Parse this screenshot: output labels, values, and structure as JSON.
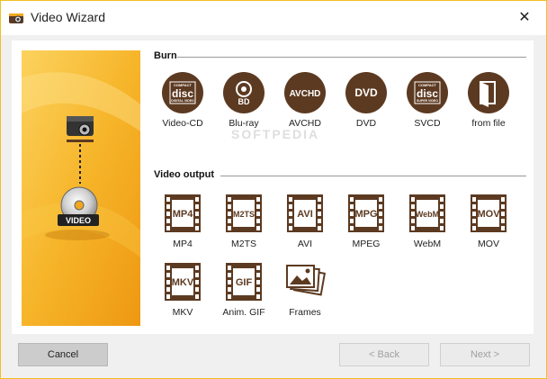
{
  "window": {
    "title": "Video Wizard",
    "close_glyph": "✕"
  },
  "colors": {
    "accent_brown": "#5c3a21",
    "banner_orange": "#f3a71e",
    "banner_light": "#fcd25e"
  },
  "banner": {
    "badge_label": "VIDEO"
  },
  "watermark": "SOFTPEDIA",
  "burn": {
    "title": "Burn",
    "items": [
      {
        "label": "Video-CD",
        "icon": "compact-disc-digital-video-icon",
        "lines": [
          "COMPACT",
          "disc",
          "DIGITAL VIDEO"
        ]
      },
      {
        "label": "Blu-ray",
        "icon": "blu-ray-disc-icon",
        "lines": [
          "BD"
        ]
      },
      {
        "label": "AVCHD",
        "icon": "avchd-icon",
        "lines": [
          "AVCHD"
        ]
      },
      {
        "label": "DVD",
        "icon": "dvd-icon",
        "lines": [
          "DVD"
        ]
      },
      {
        "label": "SVCD",
        "icon": "compact-disc-super-video-icon",
        "lines": [
          "COMPACT",
          "disc",
          "SUPER VIDEO"
        ]
      },
      {
        "label": "from file",
        "icon": "open-file-icon",
        "lines": []
      }
    ]
  },
  "video_output": {
    "title": "Video output",
    "items": [
      {
        "label": "MP4",
        "icon": "mp4-film-icon",
        "code": "MP4"
      },
      {
        "label": "M2TS",
        "icon": "m2ts-film-icon",
        "code": "M2TS"
      },
      {
        "label": "AVI",
        "icon": "avi-film-icon",
        "code": "AVI"
      },
      {
        "label": "MPEG",
        "icon": "mpeg-film-icon",
        "code": "MPG"
      },
      {
        "label": "WebM",
        "icon": "webm-film-icon",
        "code": "WebM"
      },
      {
        "label": "MOV",
        "icon": "mov-film-icon",
        "code": "MOV"
      },
      {
        "label": "MKV",
        "icon": "mkv-film-icon",
        "code": "MKV"
      },
      {
        "label": "Anim. GIF",
        "icon": "gif-film-icon",
        "code": "GIF"
      },
      {
        "label": "Frames",
        "icon": "frames-pictures-icon",
        "code": ""
      }
    ]
  },
  "buttons": {
    "cancel": "Cancel",
    "back": "< Back",
    "next": "Next >"
  }
}
